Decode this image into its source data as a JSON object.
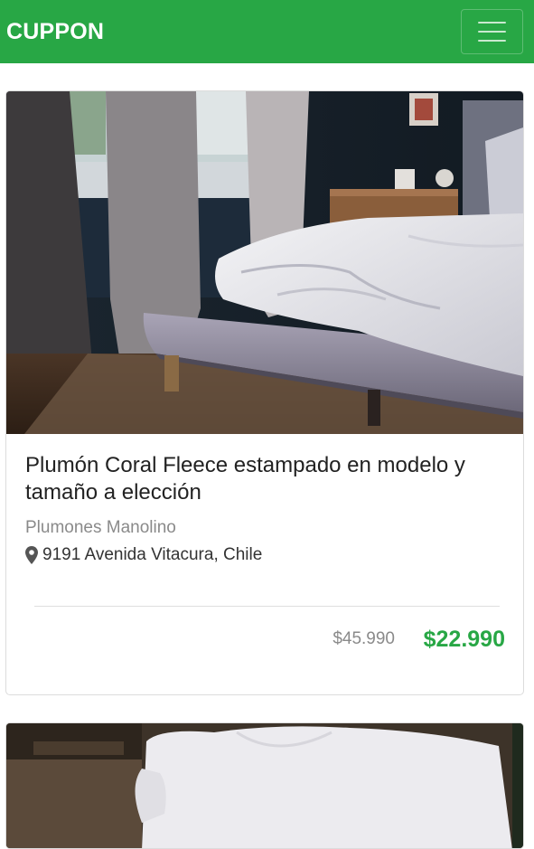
{
  "navbar": {
    "brand": "CUPPON",
    "brand_color": "#ffffff",
    "background": "#28a745",
    "menu_icon": "hamburger-menu-icon"
  },
  "deals": [
    {
      "title": "Plumón Coral Fleece estampado en modelo y tamaño a elección",
      "merchant": "Plumones Manolino",
      "address": "9191 Avenida Vitacura, Chile",
      "address_icon": "map-marker-icon",
      "old_price": "$45.990",
      "new_price": "$22.990",
      "price_color": "#28a745"
    }
  ]
}
